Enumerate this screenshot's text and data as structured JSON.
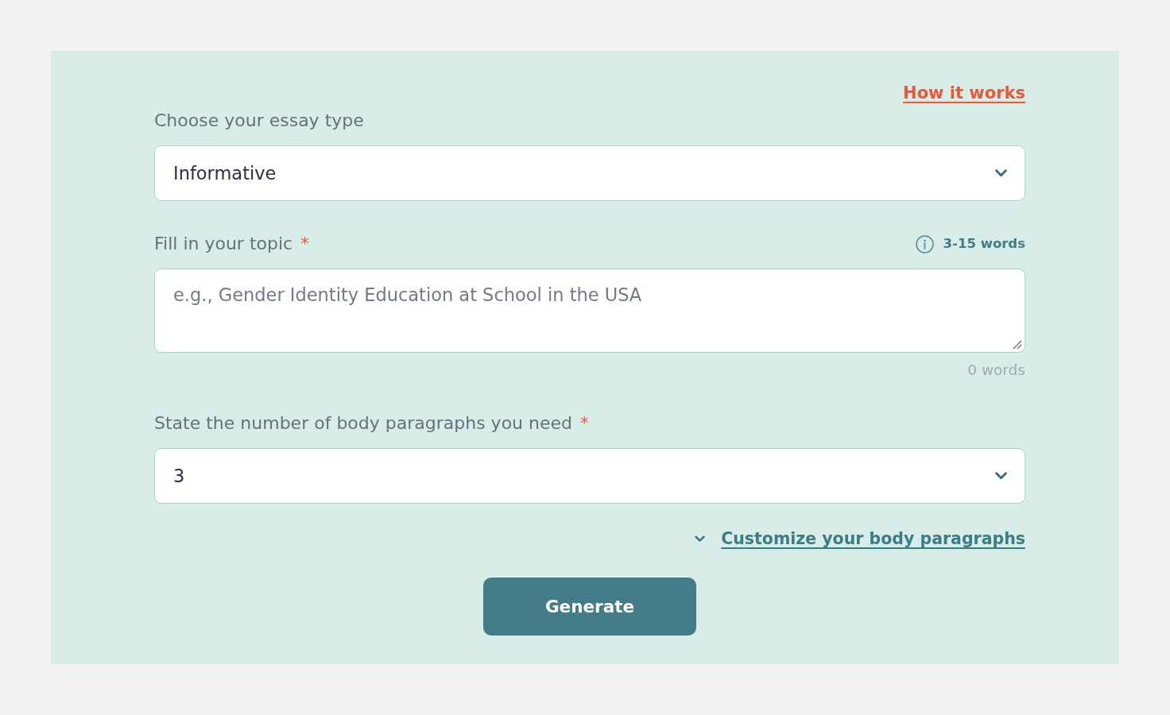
{
  "help_link": {
    "label": "How it works"
  },
  "fields": [
    {
      "kind": "select",
      "label": "Choose your essay type",
      "value": "Informative"
    },
    {
      "kind": "textarea",
      "label": "Fill in your topic",
      "required_mark": "*",
      "hint": "3-15 words",
      "placeholder": "e.g., Gender Identity Education at School in the USA",
      "counter": "0 words"
    },
    {
      "kind": "select",
      "label": "State the number of body paragraphs you need",
      "required_mark": "*",
      "value": "3"
    }
  ],
  "customize_toggle": {
    "label": "Customize your body paragraphs",
    "expanded": false
  },
  "submit_button": {
    "label": "Generate"
  }
}
